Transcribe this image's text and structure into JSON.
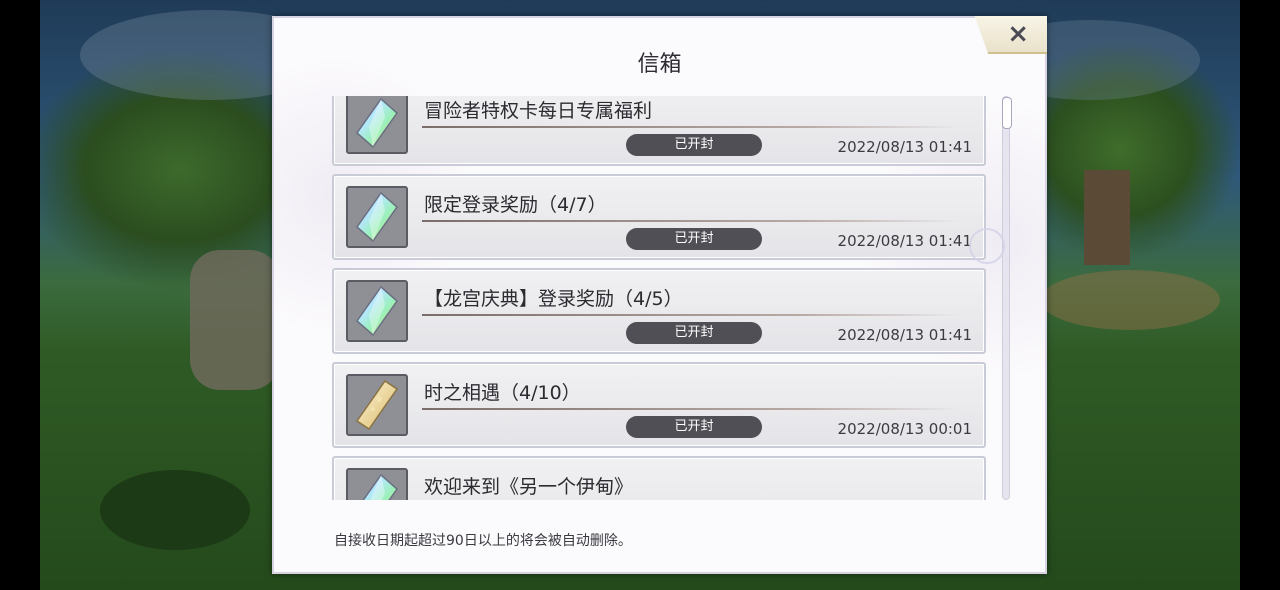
{
  "dialog": {
    "title": "信箱",
    "close_label": "×",
    "footer_note": "自接收日期起超过90日以上的将会被自动删除。"
  },
  "mail_items": [
    {
      "subject": "冒险者特权卡每日专属福利",
      "status": "已开封",
      "date": "2022/08/13 01:41",
      "icon": "crystal-icon"
    },
    {
      "subject": "限定登录奖励（4/7）",
      "status": "已开封",
      "date": "2022/08/13 01:41",
      "icon": "crystal-icon"
    },
    {
      "subject": "【龙宫庆典】登录奖励（4/5）",
      "status": "已开封",
      "date": "2022/08/13 01:41",
      "icon": "crystal-icon"
    },
    {
      "subject": "时之相遇（4/10）",
      "status": "已开封",
      "date": "2022/08/13 00:01",
      "icon": "ticket-icon"
    },
    {
      "subject": "欢迎来到《另一个伊甸》",
      "status": "",
      "date": "",
      "icon": "crystal-icon"
    }
  ],
  "scroll_position": 0.0
}
